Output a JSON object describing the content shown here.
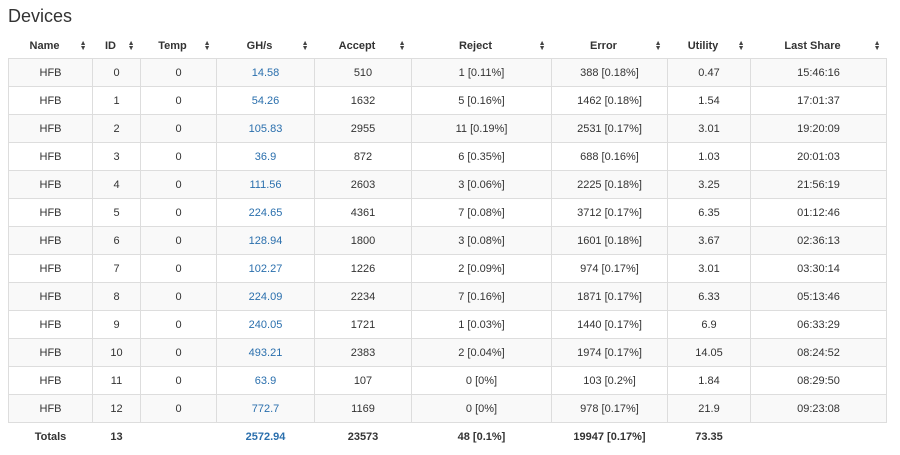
{
  "page": {
    "title": "Devices"
  },
  "table": {
    "columns": [
      "Name",
      "ID",
      "Temp",
      "GH/s",
      "Accept",
      "Reject",
      "Error",
      "Utility",
      "Last Share"
    ],
    "rows": [
      [
        "HFB",
        "0",
        "0",
        "14.58",
        "510",
        "1 [0.11%]",
        "388 [0.18%]",
        "0.47",
        "15:46:16"
      ],
      [
        "HFB",
        "1",
        "0",
        "54.26",
        "1632",
        "5 [0.16%]",
        "1462 [0.18%]",
        "1.54",
        "17:01:37"
      ],
      [
        "HFB",
        "2",
        "0",
        "105.83",
        "2955",
        "11 [0.19%]",
        "2531 [0.17%]",
        "3.01",
        "19:20:09"
      ],
      [
        "HFB",
        "3",
        "0",
        "36.9",
        "872",
        "6 [0.35%]",
        "688 [0.16%]",
        "1.03",
        "20:01:03"
      ],
      [
        "HFB",
        "4",
        "0",
        "111.56",
        "2603",
        "3 [0.06%]",
        "2225 [0.18%]",
        "3.25",
        "21:56:19"
      ],
      [
        "HFB",
        "5",
        "0",
        "224.65",
        "4361",
        "7 [0.08%]",
        "3712 [0.17%]",
        "6.35",
        "01:12:46"
      ],
      [
        "HFB",
        "6",
        "0",
        "128.94",
        "1800",
        "3 [0.08%]",
        "1601 [0.18%]",
        "3.67",
        "02:36:13"
      ],
      [
        "HFB",
        "7",
        "0",
        "102.27",
        "1226",
        "2 [0.09%]",
        "974 [0.17%]",
        "3.01",
        "03:30:14"
      ],
      [
        "HFB",
        "8",
        "0",
        "224.09",
        "2234",
        "7 [0.16%]",
        "1871 [0.17%]",
        "6.33",
        "05:13:46"
      ],
      [
        "HFB",
        "9",
        "0",
        "240.05",
        "1721",
        "1 [0.03%]",
        "1440 [0.17%]",
        "6.9",
        "06:33:29"
      ],
      [
        "HFB",
        "10",
        "0",
        "493.21",
        "2383",
        "2 [0.04%]",
        "1974 [0.17%]",
        "14.05",
        "08:24:52"
      ],
      [
        "HFB",
        "11",
        "0",
        "63.9",
        "107",
        "0 [0%]",
        "103 [0.2%]",
        "1.84",
        "08:29:50"
      ],
      [
        "HFB",
        "12",
        "0",
        "772.7",
        "1169",
        "0 [0%]",
        "978 [0.17%]",
        "21.9",
        "09:23:08"
      ]
    ],
    "totals": [
      "Totals",
      "13",
      "",
      "2572.94",
      "23573",
      "48 [0.1%]",
      "19947 [0.17%]",
      "73.35",
      ""
    ]
  },
  "icons": {
    "sort": "sort-icon"
  },
  "colors": {
    "link": "#2a6fad",
    "stripe": "#f9f9f9",
    "border": "#dddddd",
    "text": "#333333"
  }
}
